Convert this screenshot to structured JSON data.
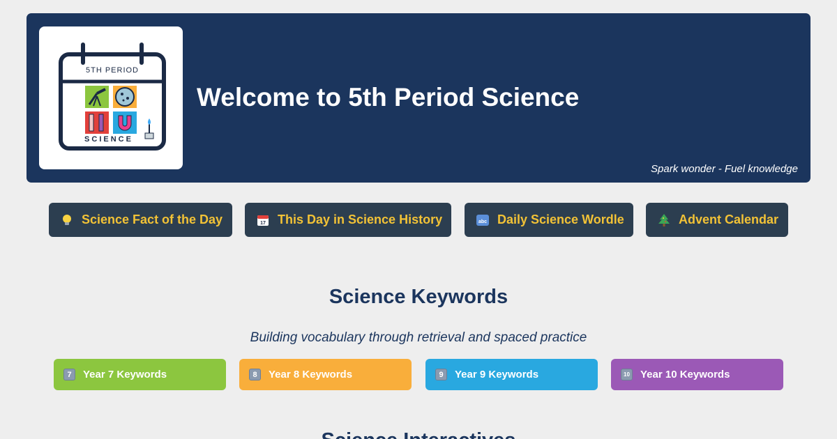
{
  "header": {
    "title": "Welcome to 5th Period Science",
    "tagline": "Spark wonder - Fuel knowledge",
    "logo": {
      "top_text": "5TH PERIOD",
      "bottom_text": "SCIENCE"
    }
  },
  "nav": [
    {
      "label": "Science Fact of the Day",
      "icon": "lightbulb-icon"
    },
    {
      "label": "This Day in Science History",
      "icon": "calendar-icon"
    },
    {
      "label": "Daily Science Wordle",
      "icon": "abc-icon"
    },
    {
      "label": "Advent Calendar",
      "icon": "christmas-tree-icon"
    }
  ],
  "keywords_section": {
    "title": "Science Keywords",
    "subtitle": "Building vocabulary through retrieval and spaced practice",
    "buttons": [
      {
        "label": "Year 7 Keywords",
        "number": "7",
        "color": "#8cc63f"
      },
      {
        "label": "Year 8 Keywords",
        "number": "8",
        "color": "#f9ae3b"
      },
      {
        "label": "Year 9 Keywords",
        "number": "9",
        "color": "#29a8e0"
      },
      {
        "label": "Year 10 Keywords",
        "number": "10",
        "color": "#9b59b6"
      }
    ]
  },
  "interactives_section": {
    "title": "Science Interactives"
  },
  "colors": {
    "banner": "#1b355d",
    "nav_bg": "#2c3e50",
    "nav_text": "#f2c236",
    "page_bg": "#eeeeee"
  }
}
